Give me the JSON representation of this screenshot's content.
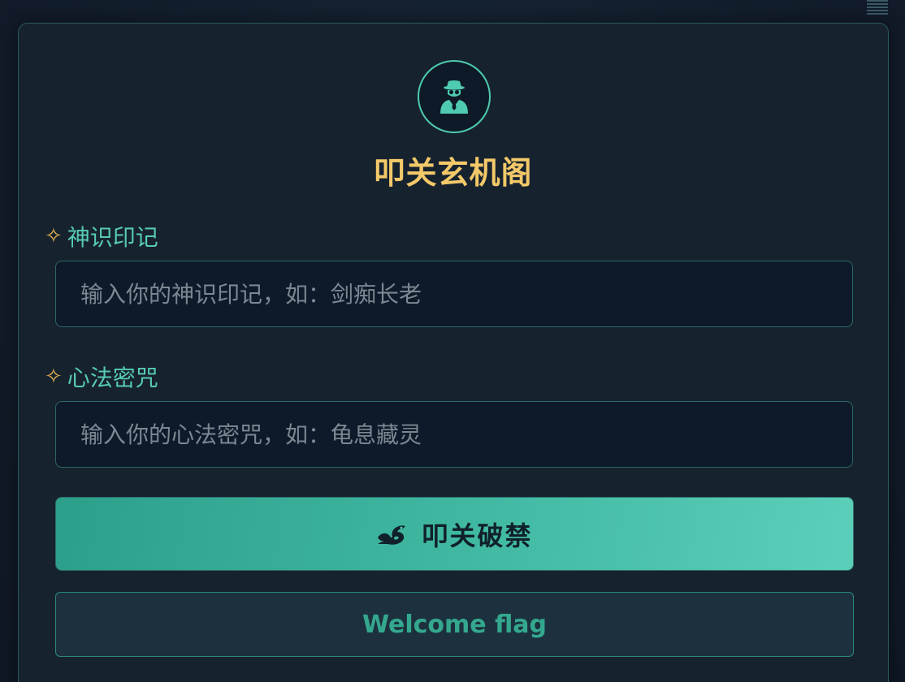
{
  "app": {
    "title": "叩关玄机阁"
  },
  "form": {
    "username": {
      "label": "神识印记",
      "placeholder": "输入你的神识印记，如：剑痴长老",
      "value": ""
    },
    "password": {
      "label": "心法密咒",
      "placeholder": "输入你的心法密咒，如：龟息藏灵",
      "value": ""
    },
    "label_marker": "✧",
    "submit_label": "叩关破禁",
    "secondary_label": "Welcome flag"
  },
  "icons": {
    "logo": "spy-icon",
    "submit": "dragon-icon",
    "menu": "menu-icon"
  },
  "colors": {
    "accent": "#4ecbb0",
    "title": "#f3c969",
    "label_marker": "#e2b34d"
  }
}
